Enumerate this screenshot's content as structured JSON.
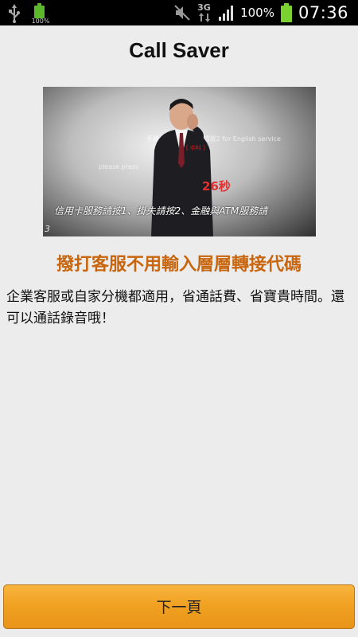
{
  "status_bar": {
    "battery_small_label": "100%",
    "network_type": "3G",
    "battery_percent": "100%",
    "time": "07:36",
    "icons": [
      "usb-icon",
      "battery-icon",
      "mute-icon",
      "network-3g-icon",
      "signal-icon",
      "battery-icon"
    ],
    "battery_color": "#7ad12f"
  },
  "app": {
    "title": "Call Saver"
  },
  "hero_image": {
    "description_icon": "businessman-phone-image",
    "counter": "26秒",
    "red_mark": "[ 中科 ]",
    "ghost_line_1": "手機驗證碼按1  台語請按2  for English service",
    "ghost_line_2": "please press",
    "menu_line": "信用卡服務請按1、掛失請按2、金融與ATM服務請",
    "corner_text": "3"
  },
  "content": {
    "headline": "撥打客服不用輸入層層轉接代碼",
    "headline_color": "#c8650d",
    "description": "企業客服或自家分機都適用，省通話費、省寶貴時間。還可以通話錄音哦！"
  },
  "footer": {
    "next_button_label": "下一頁",
    "button_color": "#f0a020"
  }
}
